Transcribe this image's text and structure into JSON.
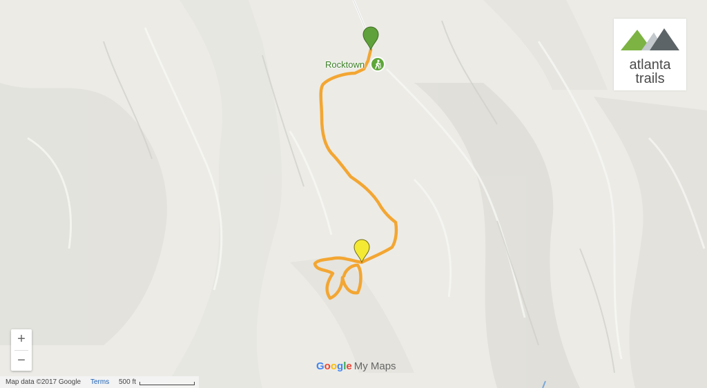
{
  "map": {
    "poi_label": "Rocktown",
    "poi_icon": "hiking-icon",
    "start_marker_color": "#5fa13a",
    "end_marker_color": "#f4ea33",
    "trail_color": "#f3a632"
  },
  "logo": {
    "line1": "atlanta",
    "line2": "trails",
    "colors": {
      "green": "#7cb342",
      "light": "#c3c9cc",
      "dark": "#5d6467"
    }
  },
  "controls": {
    "zoom_in": "+",
    "zoom_out": "−"
  },
  "branding": {
    "google": "Google",
    "my_maps": "My Maps"
  },
  "footer": {
    "map_data": "Map data ©2017 Google",
    "terms": "Terms",
    "scale": "500 ft"
  }
}
